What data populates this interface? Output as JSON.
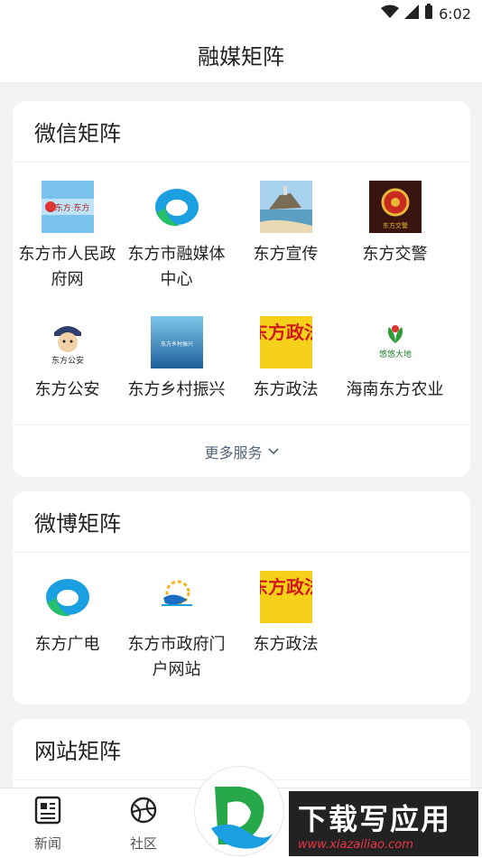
{
  "status": {
    "time": "6:02"
  },
  "header": {
    "title": "融媒矩阵"
  },
  "wechat": {
    "title": "微信矩阵",
    "items": [
      {
        "label": "东方市人民政府网",
        "icon": "gov-badge-icon"
      },
      {
        "label": "东方市融媒体中心",
        "icon": "media-logo-icon"
      },
      {
        "label": "东方宣传",
        "icon": "lighthouse-photo-icon"
      },
      {
        "label": "东方交警",
        "icon": "police-emblem-icon"
      },
      {
        "label": "东方公安",
        "icon": "police-cartoon-icon"
      },
      {
        "label": "东方乡村振兴",
        "icon": "rural-revival-icon"
      },
      {
        "label": "东方政法",
        "icon": "politics-law-icon"
      },
      {
        "label": "海南东方农业",
        "icon": "agriculture-logo-icon"
      }
    ],
    "more_label": "更多服务"
  },
  "weibo": {
    "title": "微博矩阵",
    "items": [
      {
        "label": "东方广电",
        "icon": "media-logo-icon"
      },
      {
        "label": "东方市政府门户网站",
        "icon": "gov-portal-icon"
      },
      {
        "label": "东方政法",
        "icon": "politics-law-icon"
      }
    ]
  },
  "website": {
    "title": "网站矩阵"
  },
  "tabs": [
    {
      "label": "新闻",
      "icon": "news-icon"
    },
    {
      "label": "社区",
      "icon": "community-icon"
    }
  ],
  "icon_text": {
    "gov": "东方·东方",
    "police_cartoon": "东方公安",
    "rural": "东方乡村振兴",
    "law": "东方政法",
    "agri": "悠悠大地",
    "traffic": "东方交警"
  },
  "watermark": {
    "big": "下载写应用",
    "small": "www.xiazailiao.com"
  },
  "colors": {
    "accent": "#1a9fe0",
    "law_red": "#d01818",
    "law_yellow": "#f5d11a"
  }
}
